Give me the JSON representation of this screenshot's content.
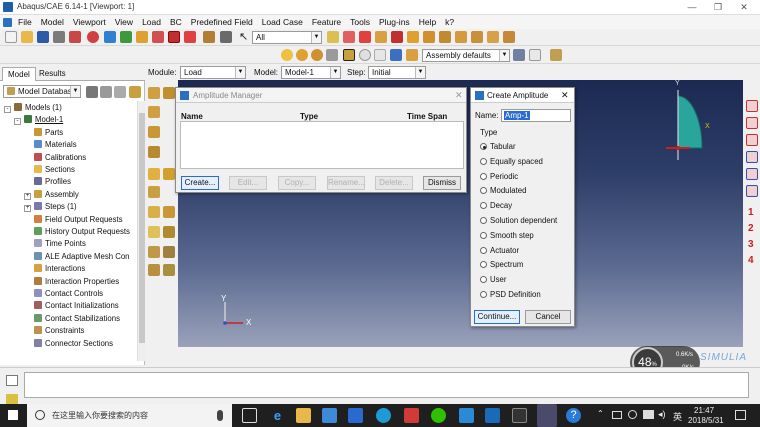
{
  "window": {
    "title": "Abaqus/CAE 6.14-1 [Viewport: 1]",
    "controls": {
      "minimize": "—",
      "restore": "❐",
      "close": "✕"
    }
  },
  "menubar": {
    "items": [
      "File",
      "Model",
      "Viewport",
      "View",
      "Load",
      "BC",
      "Predefined Field",
      "Load Case",
      "Feature",
      "Tools",
      "Plug-ins",
      "Help",
      "k?"
    ]
  },
  "toolbar": {
    "selection_filter": "All",
    "assembly_defaults": "Assembly defaults"
  },
  "context": {
    "module_label": "Module:",
    "module_value": "Load",
    "model_label": "Model:",
    "model_value": "Model-1",
    "step_label": "Step:",
    "step_value": "Initial"
  },
  "leftpanel": {
    "tabs": [
      "Model",
      "Results"
    ],
    "database_combo": "Model Database",
    "tree": [
      {
        "label": "Models (1)",
        "level": 0,
        "expander": "-"
      },
      {
        "label": "Model-1",
        "level": 1,
        "expander": "-",
        "underline": true
      },
      {
        "label": "Parts",
        "level": 2,
        "expander": ""
      },
      {
        "label": "Materials",
        "level": 2,
        "expander": ""
      },
      {
        "label": "Calibrations",
        "level": 2,
        "expander": ""
      },
      {
        "label": "Sections",
        "level": 2,
        "expander": ""
      },
      {
        "label": "Profiles",
        "level": 2,
        "expander": ""
      },
      {
        "label": "Assembly",
        "level": 2,
        "expander": "+"
      },
      {
        "label": "Steps (1)",
        "level": 2,
        "expander": "+"
      },
      {
        "label": "Field Output Requests",
        "level": 2,
        "expander": ""
      },
      {
        "label": "History Output Requests",
        "level": 2,
        "expander": ""
      },
      {
        "label": "Time Points",
        "level": 2,
        "expander": ""
      },
      {
        "label": "ALE Adaptive Mesh Con",
        "level": 2,
        "expander": ""
      },
      {
        "label": "Interactions",
        "level": 2,
        "expander": ""
      },
      {
        "label": "Interaction Properties",
        "level": 2,
        "expander": ""
      },
      {
        "label": "Contact Controls",
        "level": 2,
        "expander": ""
      },
      {
        "label": "Contact Initializations",
        "level": 2,
        "expander": ""
      },
      {
        "label": "Contact Stabilizations",
        "level": 2,
        "expander": ""
      },
      {
        "label": "Constraints",
        "level": 2,
        "expander": ""
      },
      {
        "label": "Connector Sections",
        "level": 2,
        "expander": ""
      }
    ]
  },
  "amplitude_manager": {
    "title": "Amplitude Manager",
    "columns": [
      "Name",
      "Type",
      "Time Span"
    ],
    "buttons": {
      "create": "Create...",
      "edit": "Edit...",
      "copy": "Copy...",
      "rename": "Rename...",
      "delete": "Delete...",
      "dismiss": "Dismiss"
    }
  },
  "create_amplitude": {
    "title": "Create Amplitude",
    "name_label": "Name:",
    "name_value": "Amp-1",
    "type_label": "Type",
    "types": [
      "Tabular",
      "Equally spaced",
      "Periodic",
      "Modulated",
      "Decay",
      "Solution dependent",
      "Smooth step",
      "Actuator",
      "Spectrum",
      "User",
      "PSD Definition"
    ],
    "selected_type": "Tabular",
    "continue_label": "Continue...",
    "cancel_label": "Cancel"
  },
  "viewport": {
    "triad_labels": {
      "x": "X",
      "y": "Y"
    },
    "part_triad": {
      "x": "X",
      "y": "Y"
    },
    "brand": "SIMULIA"
  },
  "rightstrip": {
    "numbers": [
      "1",
      "2",
      "3",
      "4"
    ]
  },
  "network_widget": {
    "percent": "48",
    "percent_sign": "%",
    "up": "0.6K/s",
    "down": "0K/s"
  },
  "taskbar": {
    "search_placeholder": "在这里输入你要搜索的内容",
    "time": "21:47",
    "date": "2018/5/31",
    "ime": "英"
  },
  "colors": {
    "accent": "#1f5fa8",
    "viewport_top": "#1b2a52",
    "viewport_bottom": "#9aa2ba",
    "number_red": "#d21c1c"
  }
}
